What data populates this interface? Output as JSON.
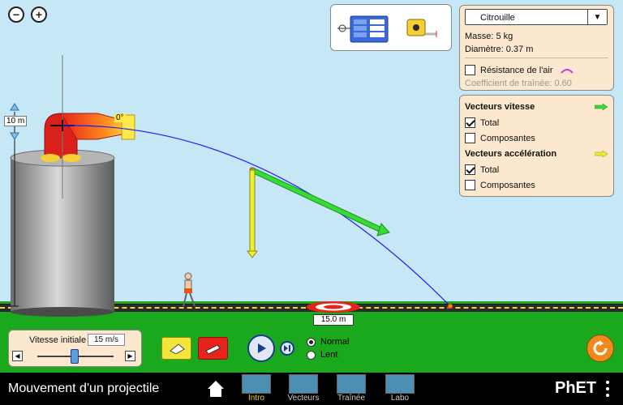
{
  "app": {
    "title": "Mouvement d'un projectile",
    "brand": "PhET"
  },
  "zoom": {
    "out_icon": "zoom-out-icon",
    "in_icon": "zoom-in-icon"
  },
  "cannon": {
    "angle_label": "0°",
    "height_label": "10 m"
  },
  "target": {
    "distance_label": "15.0 m"
  },
  "projectile_panel": {
    "selected_object": "Citrouille",
    "mass_label": "Masse: 5 kg",
    "diameter_label": "Diamètre: 0.37 m",
    "air_resistance_label": "Résistance de l'air",
    "drag_coeff_label": "Coefficient de traînée: 0.60",
    "air_resistance_checked": false
  },
  "vectors_panel": {
    "velocity_title": "Vecteurs vitesse",
    "velocity_total_label": "Total",
    "velocity_total_checked": true,
    "velocity_components_label": "Composantes",
    "velocity_components_checked": false,
    "accel_title": "Vecteurs accélération",
    "accel_total_label": "Total",
    "accel_total_checked": true,
    "accel_components_label": "Composantes",
    "accel_components_checked": false
  },
  "speed_control": {
    "label": "Vitesse initiale",
    "value": "15 m/s"
  },
  "playback": {
    "normal_label": "Normal",
    "slow_label": "Lent",
    "selected": "Normal"
  },
  "nav_tabs": [
    {
      "label": "Intro",
      "active": true
    },
    {
      "label": "Vecteurs",
      "active": false
    },
    {
      "label": "Traînée",
      "active": false
    },
    {
      "label": "Labo",
      "active": false
    }
  ],
  "colors": {
    "velocity_arrow": "#33dd33",
    "accel_arrow": "#eeee33",
    "trajectory": "#1a1aff",
    "reset_button": "#f08a1c"
  }
}
